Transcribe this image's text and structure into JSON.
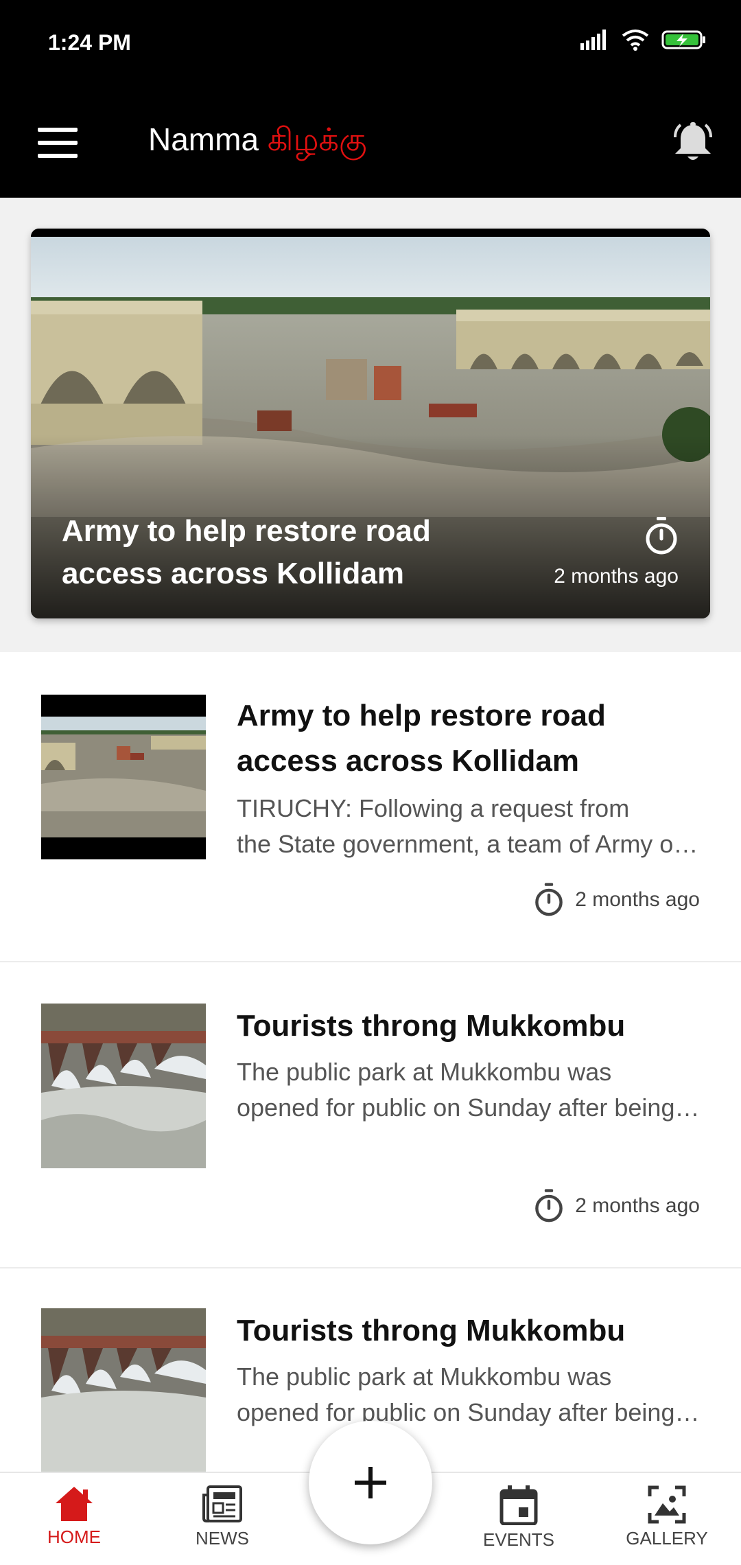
{
  "status_bar": {
    "time": "1:24 PM"
  },
  "app_bar": {
    "title_prefix": "Namma ",
    "title_accent": "கிழக்கு",
    "accent_color": "#e01010",
    "menu_icon": "hamburger-menu-icon",
    "notification_icon": "bell-icon"
  },
  "featured": {
    "title": "Army to help restore road access across Kollidam",
    "time": "2 months ago",
    "time_icon": "stopwatch-icon"
  },
  "news_items": [
    {
      "title": "Army to help restore road access across Kollidam",
      "summary_line1": "TIRUCHY: Following a request from",
      "summary_line2": "the State government, a team of Army officials",
      "time": "2 months ago"
    },
    {
      "title": "Tourists throng Mukkombu",
      "summary_line1": "The public park at Mukkombu was",
      "summary_line2": "opened for public on Sunday after being closed",
      "time": "2 months ago"
    },
    {
      "title": "Tourists throng Mukkombu",
      "summary_line1": "The public park at Mukkombu was",
      "summary_line2": "opened for public on Sunday after being closed",
      "time": ""
    }
  ],
  "bottom_nav": {
    "items": [
      {
        "label": "HOME",
        "icon": "home-icon",
        "active": true
      },
      {
        "label": "NEWS",
        "icon": "newspaper-icon",
        "active": false
      },
      {
        "label": "EVENTS",
        "icon": "calendar-icon",
        "active": false
      },
      {
        "label": "GALLERY",
        "icon": "gallery-icon",
        "active": false
      }
    ],
    "active_color": "#d51a1a",
    "fab_icon": "plus-icon"
  }
}
